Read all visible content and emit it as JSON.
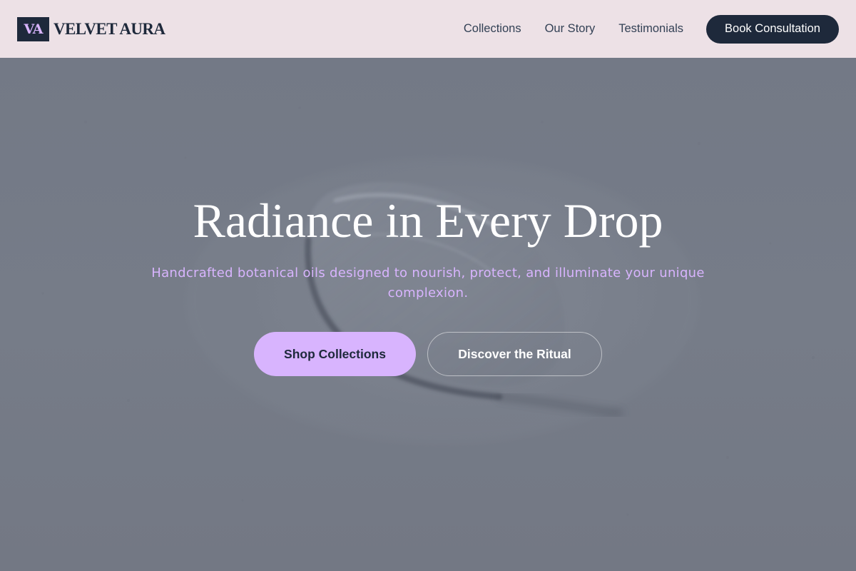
{
  "brand": {
    "badge": "VA",
    "name": "VELVET AURA"
  },
  "nav": {
    "items": [
      {
        "label": "Collections"
      },
      {
        "label": "Our Story"
      },
      {
        "label": "Testimonials"
      }
    ],
    "cta_label": "Book Consultation"
  },
  "hero": {
    "title": "Radiance in Every Drop",
    "subtitle": "Handcrafted botanical oils designed to nourish, protect, and illuminate your unique complexion.",
    "primary_button": "Shop Collections",
    "secondary_button": "Discover the Ritual",
    "background_image": "oil-drop-photo"
  },
  "colors": {
    "header_bg": "#ede1e6",
    "brand_dark": "#1e293b",
    "accent_lavender": "#d8b4fe",
    "hero_overlay": "#747a86",
    "text_light": "#ffffff"
  }
}
